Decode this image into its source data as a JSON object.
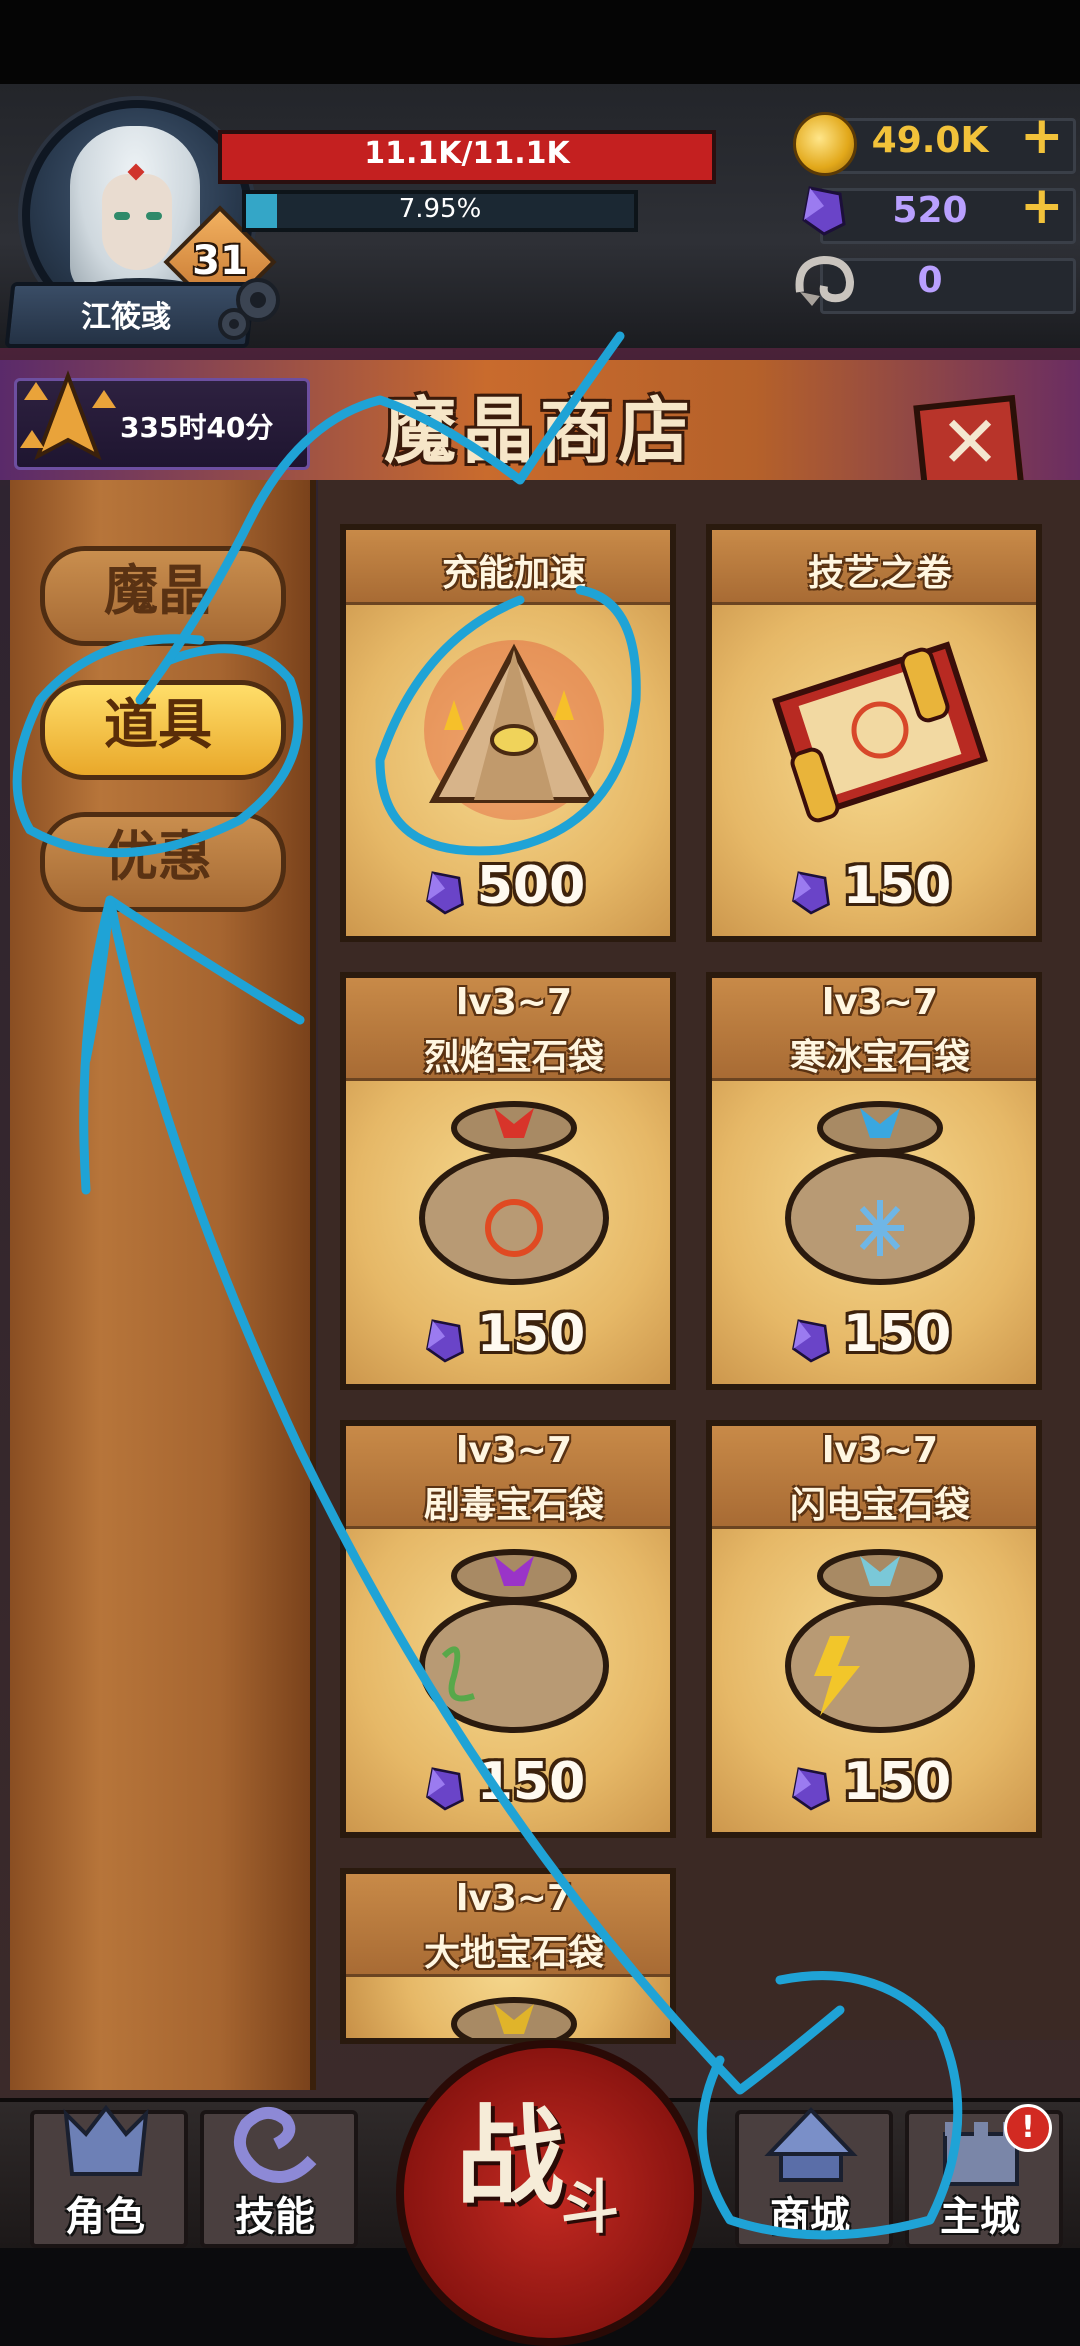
{
  "player": {
    "name": "江筱彧",
    "level": "31",
    "hp": "11.1K/11.1K",
    "exp": "7.95%",
    "exp_fraction": 0.0795
  },
  "currency": {
    "gold": "49.0K",
    "crystal": "520",
    "horn": "0",
    "plus": "+"
  },
  "shop": {
    "title": "魔晶商店",
    "timer": "335时40分",
    "close": "✕"
  },
  "tabs": [
    {
      "label": "魔晶",
      "active": false
    },
    {
      "label": "道具",
      "active": true
    },
    {
      "label": "优惠",
      "active": false
    }
  ],
  "items": [
    {
      "title": "充能加速",
      "title2": "",
      "price": "500",
      "icon": "charge-boost-pyramid-icon"
    },
    {
      "title": "技艺之卷",
      "title2": "",
      "price": "150",
      "icon": "skill-scroll-icon"
    },
    {
      "title": "lv3~7",
      "title2": "烈焰宝石袋",
      "price": "150",
      "icon": "fire-gem-bag-icon"
    },
    {
      "title": "lv3~7",
      "title2": "寒冰宝石袋",
      "price": "150",
      "icon": "ice-gem-bag-icon"
    },
    {
      "title": "lv3~7",
      "title2": "剧毒宝石袋",
      "price": "150",
      "icon": "poison-gem-bag-icon"
    },
    {
      "title": "lv3~7",
      "title2": "闪电宝石袋",
      "price": "150",
      "icon": "lightning-gem-bag-icon"
    },
    {
      "title": "lv3~7",
      "title2": "大地宝石袋",
      "price": "",
      "icon": "earth-gem-bag-icon"
    }
  ],
  "nav": {
    "character": "角色",
    "skills": "技能",
    "battle_main": "战",
    "battle_sub": "斗",
    "shop": "商城",
    "main_city": "主城",
    "alert": "!"
  },
  "colors": {
    "hp": "#c42020",
    "exp": "#34a6c7",
    "crystal": "#6a44c8",
    "annotation": "#1fa3d6"
  }
}
